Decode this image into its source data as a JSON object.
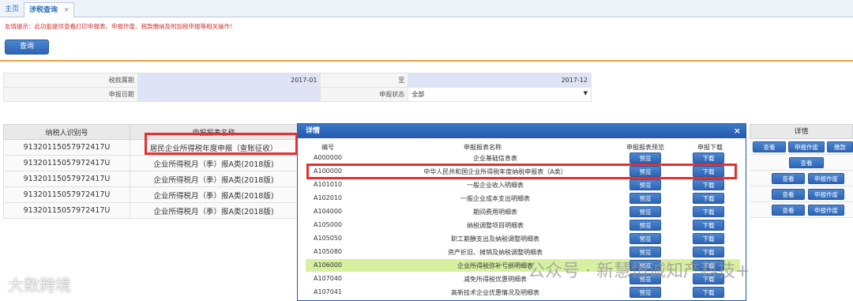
{
  "tabs": {
    "home": "主页",
    "active": "涉税查询",
    "close": "×"
  },
  "hint": "友情提示：此功能提供查看打印申报表、申报作废、税款缴纳及附加税申报等相关操作！",
  "query_button": "查询",
  "form": {
    "period_label": "税款属期",
    "period_from": "2017-01",
    "to_label": "至",
    "period_to": "2017-12",
    "date_label": "申报日期",
    "status_label": "申报状态",
    "status_value": "全部",
    "dropdown_arrow": "▼"
  },
  "grid": {
    "headers": [
      "纳税人识别号",
      "申报报表名称"
    ],
    "rows": [
      [
        "91320115057972417U",
        "居民企业所得税年度申报（查账征收）"
      ],
      [
        "91320115057972417U",
        "企业所得税月（季）报A类(2018版)"
      ],
      [
        "91320115057972417U",
        "企业所得税月（季）报A类(2018版)"
      ],
      [
        "91320115057972417U",
        "企业所得税月（季）报A类(2018版)"
      ],
      [
        "91320115057972417U",
        "企业所得税月（季）报A类(2018版)"
      ]
    ]
  },
  "details": {
    "header": "详情",
    "view": "查看",
    "void": "申报作废",
    "pay": "缴款"
  },
  "dialog": {
    "title": "详情",
    "close": "×",
    "col_code": "编号",
    "col_name": "申报报表名称",
    "col_preview": "申报报表预览",
    "col_download": "申报下载",
    "preview_btn": "预览",
    "download_btn": "下载",
    "rows": [
      {
        "code": "A000000",
        "name": "企业基础信息表"
      },
      {
        "code": "A100000",
        "name": "中华人民共和国企业所得税年度纳税申报表（A类）"
      },
      {
        "code": "A101010",
        "name": "一般企业收入明细表"
      },
      {
        "code": "A102010",
        "name": "一般企业成本支出明细表"
      },
      {
        "code": "A104000",
        "name": "期间费用明细表"
      },
      {
        "code": "A105000",
        "name": "纳税调整项目明细表"
      },
      {
        "code": "A105050",
        "name": "职工薪酬支出及纳税调整明细表"
      },
      {
        "code": "A105080",
        "name": "资产折旧、摊销及纳税调整明细表"
      },
      {
        "code": "A106000",
        "name": "企业所得税弥补亏损明细表"
      },
      {
        "code": "A107040",
        "name": "减免所得税优惠明细表"
      },
      {
        "code": "A107041",
        "name": "高新技术企业优惠情况及明细表"
      }
    ]
  },
  "watermarks": {
    "left": "大数跨境",
    "right": "公众号 · 新慧恒诚知产科技+"
  },
  "colors": {
    "accent": "#2f64b3",
    "highlight_box": "#e63030",
    "hint": "#d43030",
    "row_highlight": "#d7f0a0"
  }
}
